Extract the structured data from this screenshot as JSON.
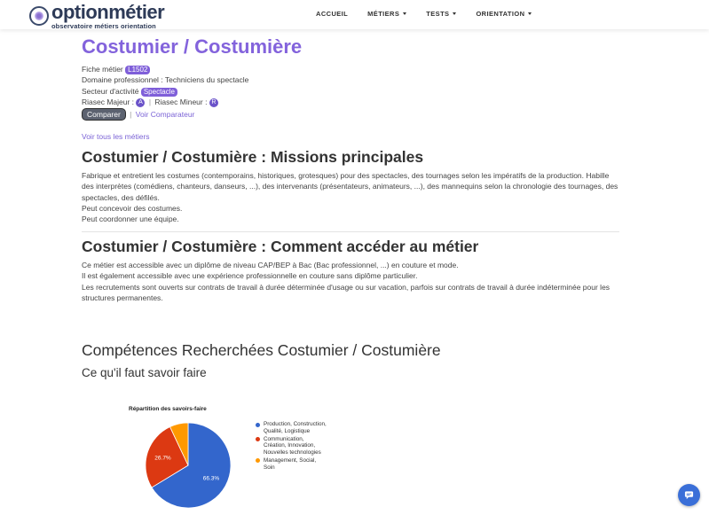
{
  "brand": {
    "name": "optionmétier",
    "tagline": "observatoire métiers orientation"
  },
  "nav": {
    "items": [
      {
        "label": "ACCUEIL",
        "dropdown": false
      },
      {
        "label": "MÉTIERS",
        "dropdown": true
      },
      {
        "label": "TESTS",
        "dropdown": true
      },
      {
        "label": "ORIENTATION",
        "dropdown": true
      }
    ]
  },
  "job": {
    "title": "Costumier / Costumière",
    "fiche_label": "Fiche métier",
    "fiche_code": "L1502",
    "domaine": "Domaine professionnel : Techniciens du spectacle",
    "secteur_label": "Secteur d'activité",
    "secteur": "Spectacle",
    "riasec_majeur_label": "Riasec Majeur :",
    "riasec_majeur": "A",
    "riasec_mineur_label": "Riasec Mineur :",
    "riasec_mineur": "R",
    "compare_label": "Comparer",
    "separator": "|",
    "voir_comparateur": "Voir Comparateur",
    "all_jobs": "Voir tous les métiers"
  },
  "missions": {
    "title": "Costumier / Costumière : Missions principales",
    "lines": [
      "Fabrique et entretient les costumes (contemporains, historiques, grotesques) pour des spectacles, des tournages selon les impératifs de la production. Habille des interprètes (comédiens, chanteurs, danseurs, ...), des intervenants (présentateurs, animateurs, ...), des mannequins selon la chronologie des tournages, des spectacles, des défilés.",
      "Peut concevoir des costumes.",
      "Peut coordonner une équipe."
    ]
  },
  "access": {
    "title": "Costumier / Costumière : Comment accéder au métier",
    "lines": [
      "Ce métier est accessible avec un diplôme de niveau CAP/BEP à Bac (Bac professionnel, ...) en couture et mode.",
      "Il est également accessible avec une expérience professionnelle en couture sans diplôme particulier.",
      "Les recrutements sont ouverts sur contrats de travail à durée déterminée d'usage ou sur vacation, parfois sur contrats de travail à durée indéterminée pour les structures permanentes."
    ]
  },
  "competences": {
    "title": "Compétences Recherchées Costumier / Costumière",
    "subtitle": "Ce qu'il faut savoir faire"
  },
  "chart_data": {
    "type": "pie",
    "title": "Répartition des savoirs-faire",
    "legend_position": "right",
    "slices": [
      {
        "label": "Production, Construction, Qualité, Logistique",
        "value": 66.3,
        "color": "#3366cc",
        "label_text": "66.3%"
      },
      {
        "label": "Communication, Création, Innovation, Nouvelles technologies",
        "value": 26.7,
        "color": "#dc3912",
        "label_text": "26.7%"
      },
      {
        "label": "Management, Social, Soin",
        "value": 7.0,
        "color": "#ff9900",
        "label_text": ""
      }
    ]
  },
  "icons": {
    "chat": "chat-bubble-icon",
    "logo": "logo-icon"
  }
}
